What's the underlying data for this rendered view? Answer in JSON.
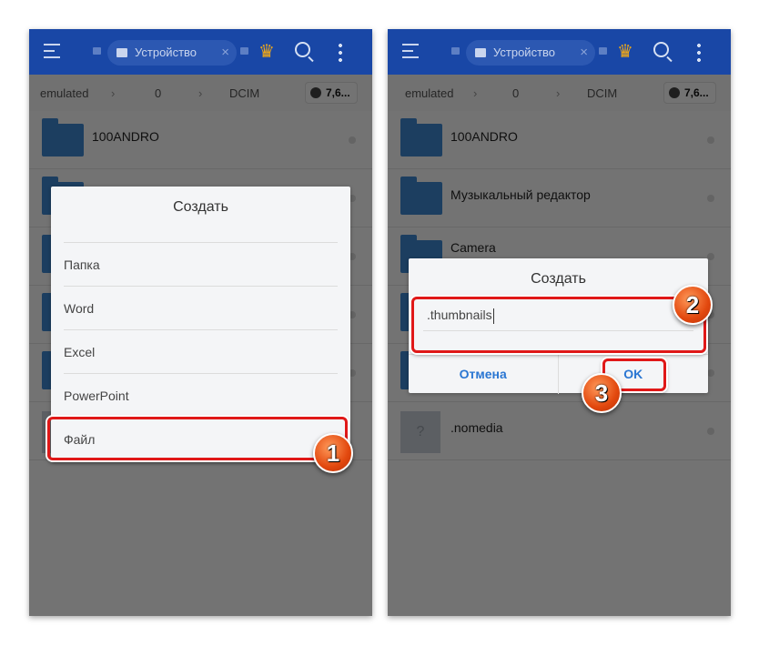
{
  "header": {
    "location": "Устройство",
    "close": "×",
    "crown": "♛"
  },
  "breadcrumb": {
    "items": [
      "emulated",
      "0",
      "DCIM"
    ],
    "separator": "›",
    "capacity": "7,6..."
  },
  "left": {
    "rows": [
      "100ANDRO",
      "",
      "",
      "",
      "",
      ""
    ],
    "dialog": {
      "title": "Создать",
      "items": [
        "Папка",
        "Word",
        "Excel",
        "PowerPoint",
        "Файл"
      ]
    },
    "badge": "1"
  },
  "right": {
    "rows": [
      "100ANDRO",
      "Музыкальный редактор",
      "Camera",
      "",
      "",
      ".nomedia"
    ],
    "dialog": {
      "title": "Создать",
      "input_value": ".thumbnails",
      "cancel": "Отмена",
      "ok": "OK"
    },
    "badges": [
      "2",
      "3"
    ]
  },
  "colors": {
    "header": "#1947a6",
    "highlight": "#e01818",
    "button_text": "#2a76d2"
  }
}
